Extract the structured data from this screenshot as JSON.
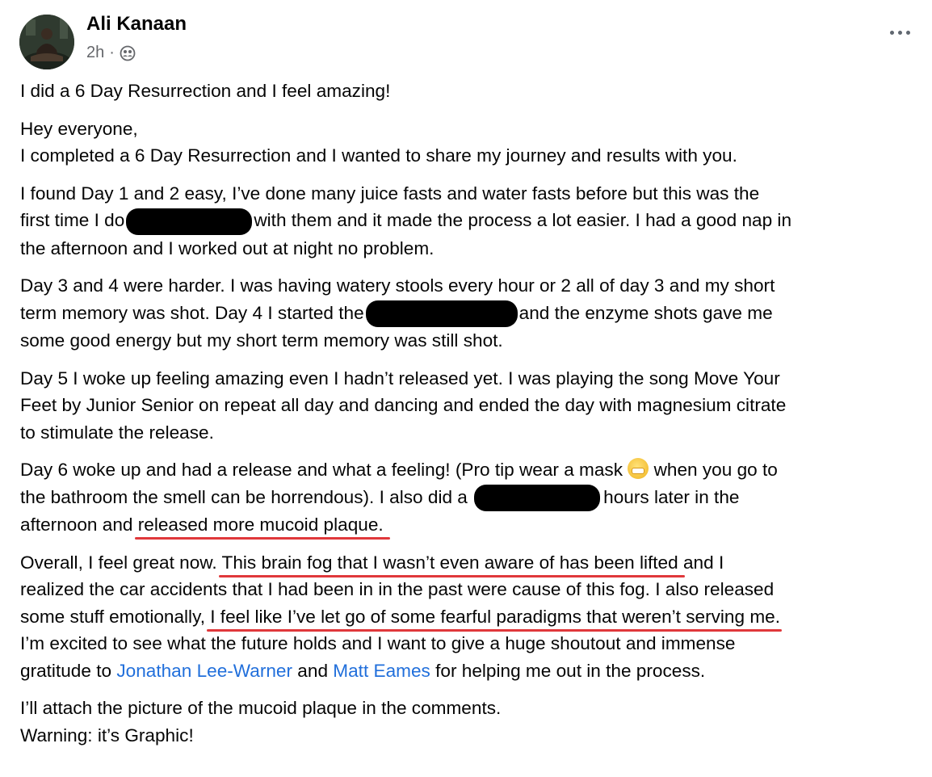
{
  "post": {
    "author": "Ali Kanaan",
    "time": "2h",
    "separator": "·",
    "audience_icon": "friends-group-icon",
    "more_icon": "more-options-icon"
  },
  "content": {
    "headline": "I did a 6 Day Resurrection and I feel amazing!",
    "greeting": "Hey everyone,",
    "intro": "I completed a 6 Day Resurrection and I wanted to share my journey and results with you.",
    "p1_l1": "I found Day 1 and 2 easy, I’ve done many juice fasts and water fasts before but this was the",
    "p1_l2a": "first time I do",
    "p1_l2b": "with them and it made the process a lot easier. I had a good nap in",
    "p1_l3": "the afternoon and I worked out at night no problem.",
    "p2_l1": "Day 3 and 4 were harder. I was having watery stools every hour or 2 all of day 3 and my short",
    "p2_l2a": "term memory was shot. Day 4 I started the",
    "p2_l2b": "and the enzyme shots gave me",
    "p2_l3": "some good energy but my short term memory was still shot.",
    "p3_l1": "Day 5 I woke up feeling amazing even I hadn’t released yet. I was playing the song Move Your",
    "p3_l2": "Feet by Junior Senior on repeat all day and dancing and ended the day with magnesium citrate",
    "p3_l3": "to stimulate the release.",
    "p4_l1a": "Day 6 woke up and had a release and what a feeling! (Pro tip wear a mask",
    "p4_l1b": " when you go to",
    "p4_l2a": "the bathroom the smell can be horrendous). I also did a",
    "p4_l2b": "hours later in the",
    "p4_l3a": "afternoon and ",
    "p4_l3_ul": "released more mucoid plaque.",
    "p5_l1a": "Overall, I feel great now. ",
    "p5_l1_ul": "This brain fog that I wasn’t even aware of has been lifted",
    "p5_l1b": " and I",
    "p5_l2": "realized the car accidents that I had been in in the past were cause of this fog. I also released",
    "p5_l3a": "some stuff emotionally, ",
    "p5_l3_ul": "I feel like I’ve let go of some fearful paradigms that weren’t serving me",
    "p5_l3b": ".",
    "p5_l4": "I’m excited to see what the future holds and I want to give a huge shoutout and immense",
    "p5_l5a": "gratitude to ",
    "mention1": "Jonathan Lee-Warner",
    "p5_l5b": " and ",
    "mention2": "Matt Eames",
    "p5_l5c": " for helping me out in the process.",
    "p6_l1": "I’ll attach the picture of the mucoid plaque in the comments.",
    "p6_l2": "Warning: it’s Graphic!"
  },
  "colors": {
    "link": "#216fdb",
    "underline": "#e0383b",
    "secondary_text": "#65676b"
  }
}
